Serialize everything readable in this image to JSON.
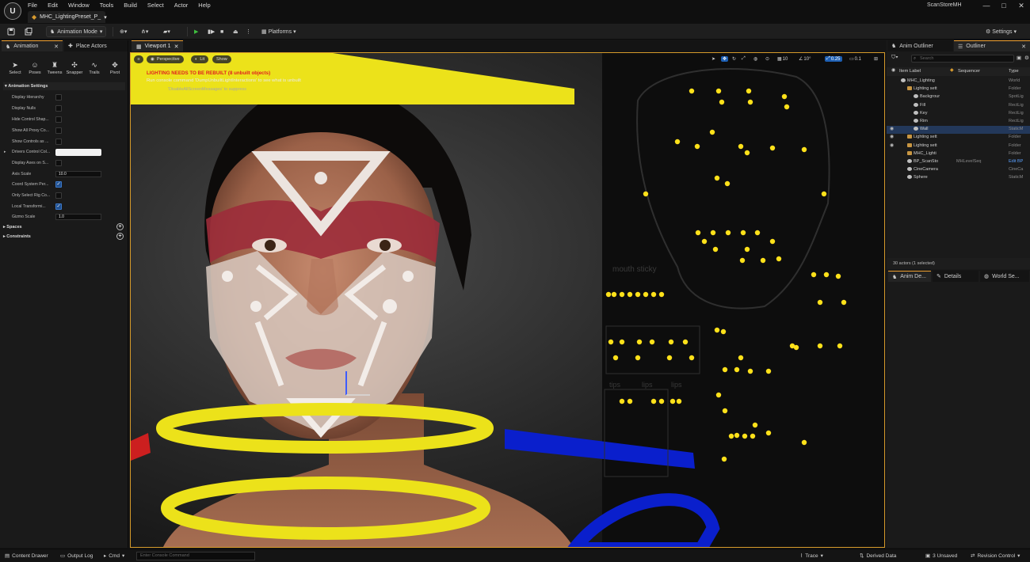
{
  "menu": {
    "logo": "U",
    "items": [
      "File",
      "Edit",
      "Window",
      "Tools",
      "Build",
      "Select",
      "Actor",
      "Help"
    ],
    "document_tab": "MHC_LightingPreset_P_",
    "document_tab_dropdown": "▾",
    "project": "ScanStoreMH",
    "window_buttons": [
      "—",
      "□",
      "✕"
    ]
  },
  "toolbar": {
    "mode": "Animation Mode",
    "platforms": "Platforms",
    "settings": "Settings"
  },
  "left_panel": {
    "tabs": [
      "Animation",
      "Place Actors"
    ],
    "tools": [
      "Select",
      "Poses",
      "Tweens",
      "Snapper",
      "Trails",
      "Pivot"
    ],
    "section_title": "Animation Settings",
    "properties": [
      {
        "label": "Display Hierarchy",
        "kind": "check",
        "on": false
      },
      {
        "label": "Display Nulls",
        "kind": "check",
        "on": false
      },
      {
        "label": "Hide Control Shap...",
        "kind": "check",
        "on": false
      },
      {
        "label": "Show All Proxy Co...",
        "kind": "check",
        "on": false
      },
      {
        "label": "Show Controls as ...",
        "kind": "check",
        "on": false
      },
      {
        "label": "Drivers Control Col...",
        "kind": "color",
        "on": false
      },
      {
        "label": "Display Axes on S...",
        "kind": "check",
        "on": false
      },
      {
        "label": "Axis Scale",
        "kind": "number",
        "value": "10.0"
      },
      {
        "label": "Coord System Per...",
        "kind": "check",
        "on": true
      },
      {
        "label": "Only Select Rig Co...",
        "kind": "check",
        "on": false
      },
      {
        "label": "Local Transformi...",
        "kind": "check",
        "on": true
      },
      {
        "label": "Gizmo Scale",
        "kind": "number",
        "value": "1.0"
      }
    ],
    "sections": [
      "Spaces",
      "Constraints"
    ]
  },
  "viewport": {
    "tab": "Viewport 1",
    "perspective": "Perspective",
    "lit": "Lit",
    "show": "Show",
    "warning_title": "LIGHTING NEEDS TO BE REBUILT (8 unbuilt objects)",
    "warning_hint": "Run console command 'DumpUnbuiltLightInteractions' to see what is unbuilt",
    "warning_suppress": "'DisableAllScreenMessages' to suppress",
    "grid_snap": "10",
    "rot_snap": "10°",
    "scale_snap": "0.25",
    "camera_speed": "0.1",
    "panel_labels": [
      "mouth sticky",
      "tips",
      "lips",
      "lips"
    ]
  },
  "outliner": {
    "tabs": [
      "Anim Outliner",
      "Outliner"
    ],
    "search_placeholder": "Search",
    "col_label": "Item Label",
    "col_sequencer": "Sequencer",
    "col_type": "Type",
    "rows": [
      {
        "name": "MHC_Lighting",
        "type": "World",
        "indent": 1,
        "icon": "world",
        "sel": false,
        "eye": false
      },
      {
        "name": "Lighting sett",
        "type": "Folder",
        "indent": 2,
        "icon": "folder",
        "sel": false,
        "eye": false
      },
      {
        "name": "Backgrour",
        "type": "SpotLig",
        "indent": 3,
        "icon": "actor",
        "sel": false,
        "eye": false
      },
      {
        "name": "Fill",
        "type": "RectLig",
        "indent": 3,
        "icon": "actor",
        "sel": false,
        "eye": false
      },
      {
        "name": "Key",
        "type": "RectLig",
        "indent": 3,
        "icon": "actor",
        "sel": false,
        "eye": false
      },
      {
        "name": "Rim",
        "type": "RectLig",
        "indent": 3,
        "icon": "actor",
        "sel": false,
        "eye": false
      },
      {
        "name": "Wall",
        "type": "StaticM",
        "indent": 3,
        "icon": "actor",
        "sel": true,
        "eye": true
      },
      {
        "name": "Lighting sett",
        "type": "Folder",
        "indent": 2,
        "icon": "folder",
        "sel": false,
        "eye": true
      },
      {
        "name": "Lighting sett",
        "type": "Folder",
        "indent": 2,
        "icon": "folder",
        "sel": false,
        "eye": true
      },
      {
        "name": "MHC_Lighti",
        "type": "Folder",
        "indent": 2,
        "icon": "folder",
        "sel": false,
        "eye": false
      },
      {
        "name": "BP_ScanSto",
        "seq": "MHLevelSeq",
        "type": "Edit BP",
        "indent": 2,
        "icon": "actor",
        "sel": false,
        "eye": false
      },
      {
        "name": "CineCamera",
        "type": "CineCa",
        "indent": 2,
        "icon": "actor",
        "sel": false,
        "eye": false
      },
      {
        "name": "Sphere",
        "type": "StaticM",
        "indent": 2,
        "icon": "actor",
        "sel": false,
        "eye": false
      }
    ],
    "footer": "30 actors (1 selected)"
  },
  "details": {
    "tabs": [
      "Anim De...",
      "Details",
      "World Se..."
    ]
  },
  "status": {
    "content_drawer": "Content Drawer",
    "output_log": "Output Log",
    "cmd": "Cmd",
    "console_placeholder": "Enter Console Command",
    "trace": "Trace",
    "derived_data": "Derived Data",
    "unsaved": "3 Unsaved",
    "revision_control": "Revision Control"
  },
  "colors": {
    "accent": "#f0a030",
    "marker_yellow": "#ffe11a",
    "marker_blue": "#0a1fcc",
    "selection": "#23385a"
  }
}
